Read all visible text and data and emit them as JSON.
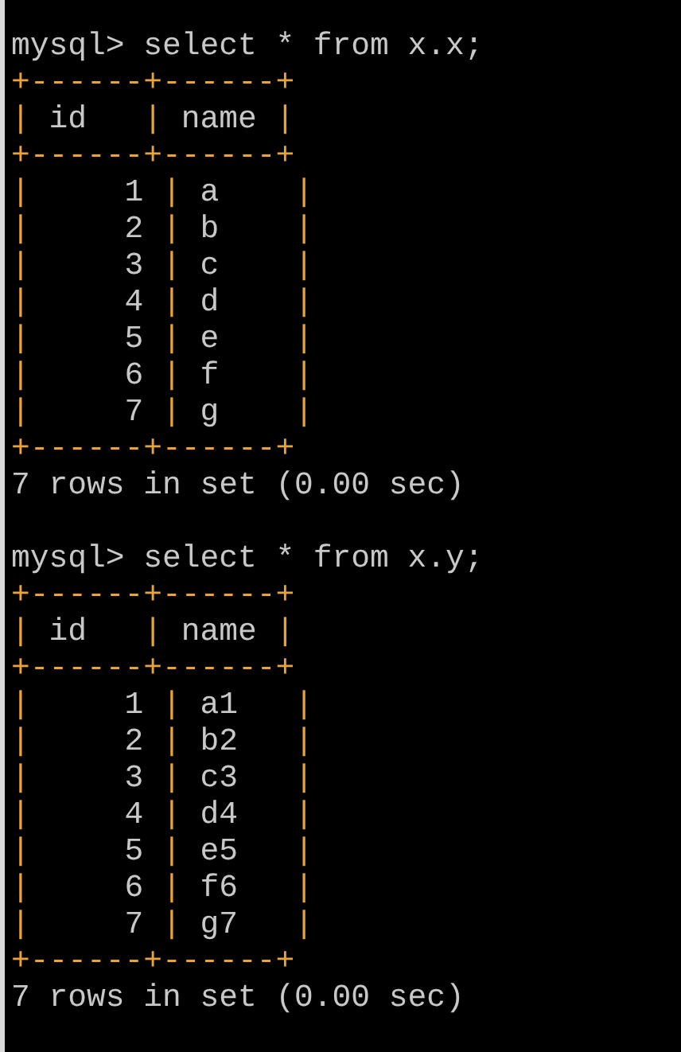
{
  "queries": [
    {
      "prompt": "mysql>",
      "command": "select * from x.x;",
      "border_top": "+------+------+",
      "header": [
        "|",
        " id   ",
        "|",
        " name ",
        "|"
      ],
      "border_mid": "+------+------+",
      "rows": [
        [
          "|",
          "     1 ",
          "|",
          " a    ",
          "|"
        ],
        [
          "|",
          "     2 ",
          "|",
          " b    ",
          "|"
        ],
        [
          "|",
          "     3 ",
          "|",
          " c    ",
          "|"
        ],
        [
          "|",
          "     4 ",
          "|",
          " d    ",
          "|"
        ],
        [
          "|",
          "     5 ",
          "|",
          " e    ",
          "|"
        ],
        [
          "|",
          "     6 ",
          "|",
          " f    ",
          "|"
        ],
        [
          "|",
          "     7 ",
          "|",
          " g    ",
          "|"
        ]
      ],
      "border_bottom": "+------+------+",
      "summary": "7 rows in set (0.00 sec)"
    },
    {
      "prompt": "mysql>",
      "command": "select * from x.y;",
      "border_top": "+------+------+",
      "header": [
        "|",
        " id   ",
        "|",
        " name ",
        "|"
      ],
      "border_mid": "+------+------+",
      "rows": [
        [
          "|",
          "     1 ",
          "|",
          " a1   ",
          "|"
        ],
        [
          "|",
          "     2 ",
          "|",
          " b2   ",
          "|"
        ],
        [
          "|",
          "     3 ",
          "|",
          " c3   ",
          "|"
        ],
        [
          "|",
          "     4 ",
          "|",
          " d4   ",
          "|"
        ],
        [
          "|",
          "     5 ",
          "|",
          " e5   ",
          "|"
        ],
        [
          "|",
          "     6 ",
          "|",
          " f6   ",
          "|"
        ],
        [
          "|",
          "     7 ",
          "|",
          " g7   ",
          "|"
        ]
      ],
      "border_bottom": "+------+------+",
      "summary": "7 rows in set (0.00 sec)"
    }
  ]
}
